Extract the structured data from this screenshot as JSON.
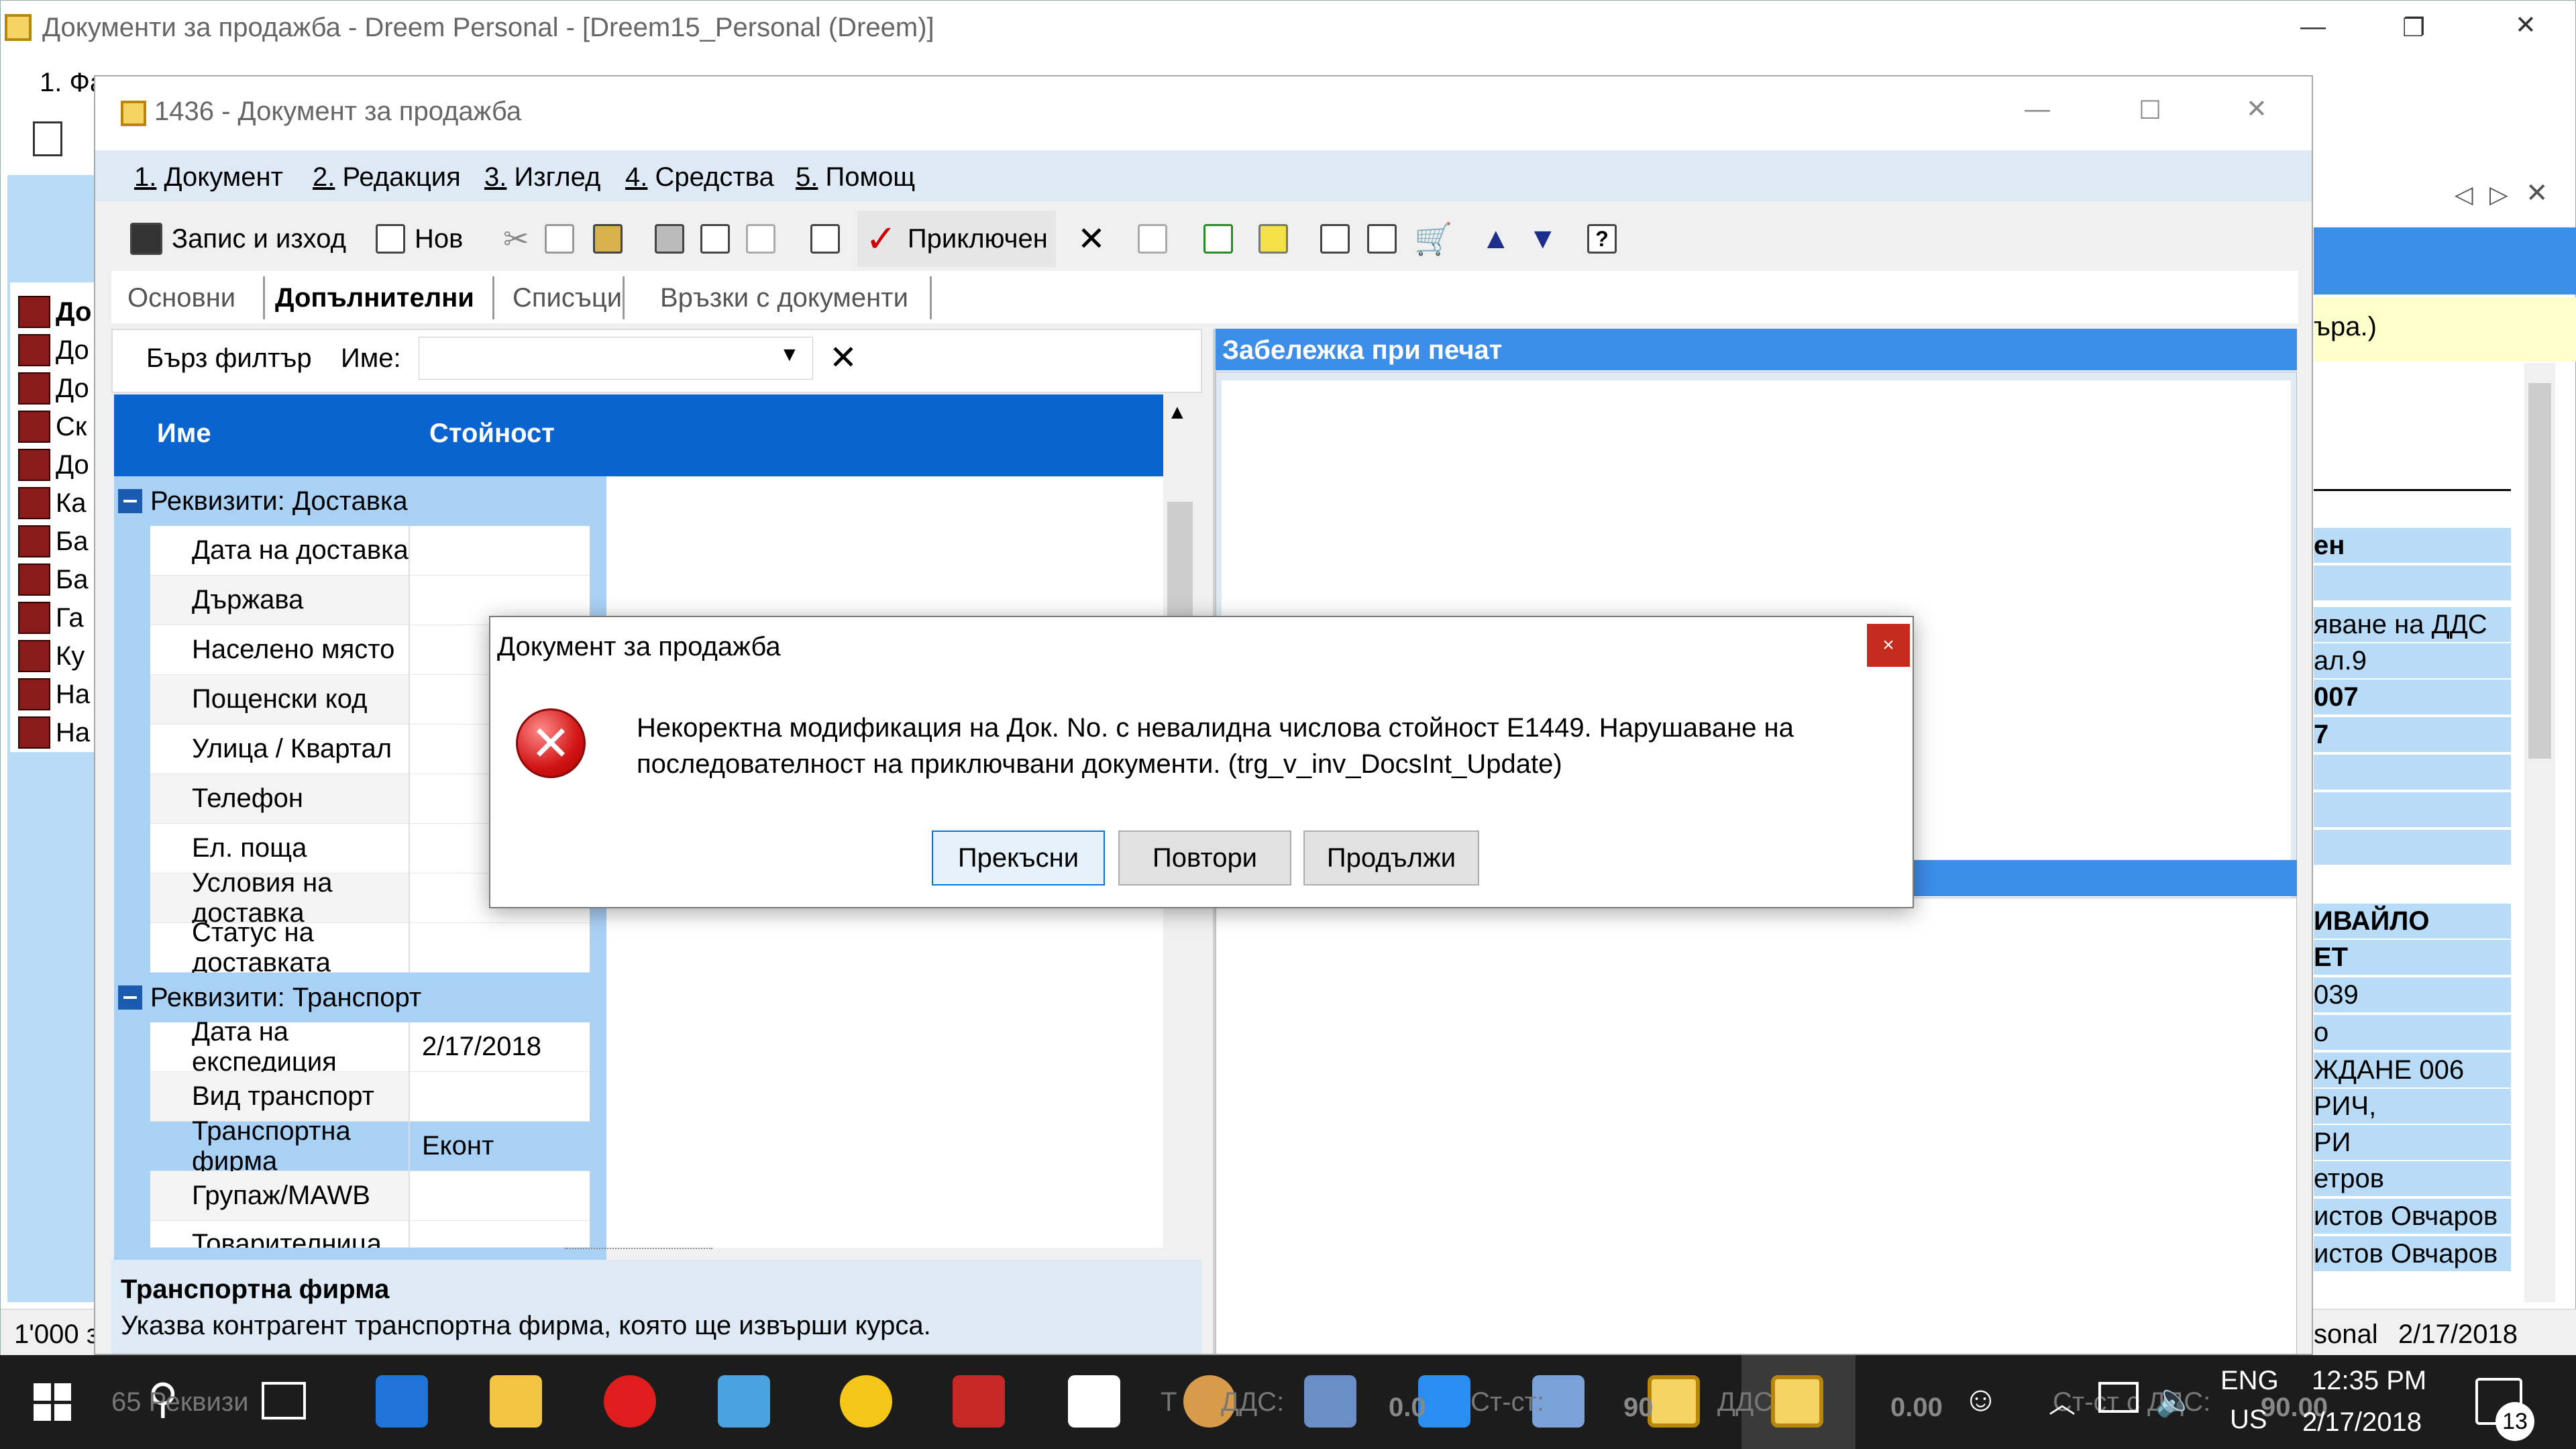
{
  "main_window": {
    "title": "Документи за продажба - Dreem Personal - [Dreem15_Personal (Dreem)]",
    "menu_partial": "1. Фа",
    "bg_list": [
      "До",
      "До",
      "До",
      "Ск",
      "До",
      "Ка",
      "Ба",
      "Ба",
      "Га",
      "Ку",
      "На",
      "На"
    ],
    "right_panel": {
      "yellow_text": "ъра.)",
      "rows": [
        "ен",
        "яване на ДДС",
        "ал.9",
        "007",
        "7",
        "ИВАЙЛО",
        "ЕТ",
        "039",
        "о",
        "ЖДАНЕ 006",
        "РИЧ,",
        "РИ",
        "етров",
        "истов Овчаров",
        "истов Овчаров"
      ]
    },
    "status_left": "1'000 з",
    "status_right_label": "sonal",
    "status_right_date": "2/17/2018",
    "bottom_behind": {
      "req_count": "65 Реквизи",
      "tot_dds": "Т",
      "dds_label": "ДДС:",
      "val1": "0.0",
      "st_label": "Ст-ст:",
      "val2": "90",
      "dds2": "ДДС",
      "val3": "0.00",
      "st2": "Ст-ст с ДДС:",
      "val4": "90.00"
    }
  },
  "doc_window": {
    "title": "1436 - Документ за продажба",
    "menu": [
      {
        "num": "1.",
        "label": "Документ"
      },
      {
        "num": "2.",
        "label": "Редакция"
      },
      {
        "num": "3.",
        "label": "Изглед"
      },
      {
        "num": "4.",
        "label": "Средства"
      },
      {
        "num": "5.",
        "label": "Помощ"
      }
    ],
    "toolbar": {
      "save_exit": "Запис и изход",
      "new": "Нов",
      "finished": "Приключен"
    },
    "tabs": [
      "Основни",
      "Допълнителни",
      "Списъци",
      "Връзки с документи"
    ],
    "filter": {
      "quick_filter": "Бърз филтър",
      "name_label": "Име:",
      "name_value": ""
    },
    "grid": {
      "col_name": "Име",
      "col_value": "Стойност",
      "group1": "Реквизити: Доставка",
      "group1_rows": [
        {
          "name": "Дата на доставка",
          "value": ""
        },
        {
          "name": "Държава",
          "value": ""
        },
        {
          "name": "Населено място",
          "value": ""
        },
        {
          "name": "Пощенски код",
          "value": ""
        },
        {
          "name": "Улица / Квартал",
          "value": ""
        },
        {
          "name": "Телефон",
          "value": ""
        },
        {
          "name": "Ел. поща",
          "value": ""
        },
        {
          "name": "Условия на доставка",
          "value": ""
        },
        {
          "name": "Статус на доставката",
          "value": ""
        }
      ],
      "group2": "Реквизити: Транспорт",
      "group2_rows": [
        {
          "name": "Дата на експедиция",
          "value": "2/17/2018"
        },
        {
          "name": "Вид транспорт",
          "value": ""
        },
        {
          "name": "Транспортна фирма",
          "value": "Еконт"
        },
        {
          "name": "Групаж/MAWB",
          "value": ""
        },
        {
          "name": "Товарителница",
          "value": ""
        }
      ]
    },
    "print_note_header": "Забележка при печат",
    "description_title": "Транспортна фирма",
    "description_text": "Указва контрагент транспортна фирма, която ще извърши курса."
  },
  "dialog": {
    "title": "Документ за продажба",
    "message": "Некоректна модификация на Док. No. с невалидна числова стойност E1449. Нарушаване на последователност на приключвани документи. (trg_v_inv_DocsInt_Update)",
    "buttons": [
      "Прекъсни",
      "Повтори",
      "Продължи"
    ],
    "close_glyph": "×"
  },
  "taskbar": {
    "lang_top": "ENG",
    "lang_bottom": "US",
    "time": "12:35 PM",
    "date": "2/17/2018",
    "notifications": "13"
  },
  "colors": {
    "grid_header": "#0a64d0",
    "group_row": "#a9d0f5",
    "panel_header": "#3c8ee8",
    "error_red": "#e02020",
    "taskbar": "#1c1c1c"
  }
}
